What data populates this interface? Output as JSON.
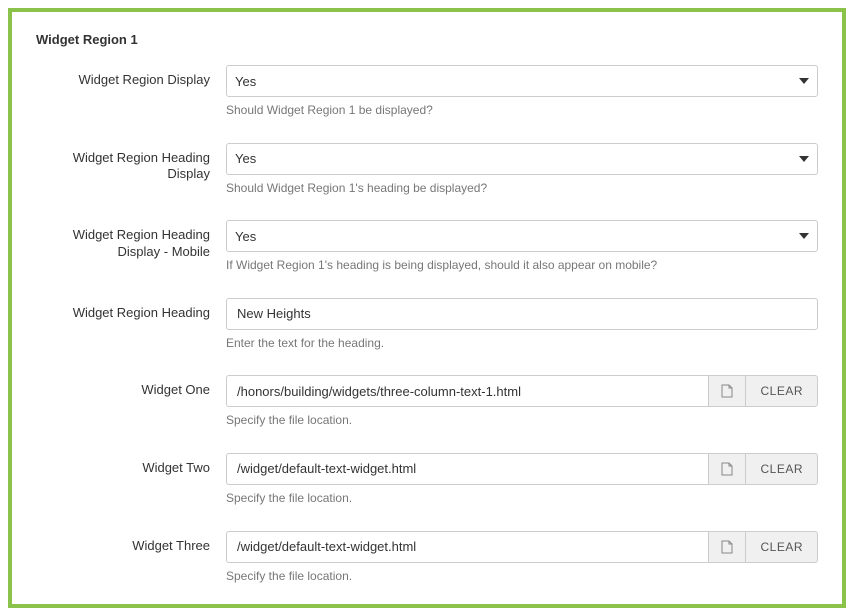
{
  "panel": {
    "title": "Widget Region 1",
    "fields": {
      "display": {
        "label": "Widget Region Display",
        "value": "Yes",
        "hint": "Should Widget Region 1 be displayed?"
      },
      "heading_display": {
        "label": "Widget Region Heading Display",
        "value": "Yes",
        "hint": "Should Widget Region 1's heading be displayed?"
      },
      "heading_display_mobile": {
        "label": "Widget Region Heading Display - Mobile",
        "value": "Yes",
        "hint": "If Widget Region 1's heading is being displayed, should it also appear on mobile?"
      },
      "heading": {
        "label": "Widget Region Heading",
        "value": "New Heights",
        "hint": "Enter the text for the heading."
      },
      "widget_one": {
        "label": "Widget One",
        "value": "/honors/building/widgets/three-column-text-1.html",
        "hint": "Specify the file location.",
        "clear": "CLEAR"
      },
      "widget_two": {
        "label": "Widget Two",
        "value": "/widget/default-text-widget.html",
        "hint": "Specify the file location.",
        "clear": "CLEAR"
      },
      "widget_three": {
        "label": "Widget Three",
        "value": "/widget/default-text-widget.html",
        "hint": "Specify the file location.",
        "clear": "CLEAR"
      }
    }
  }
}
